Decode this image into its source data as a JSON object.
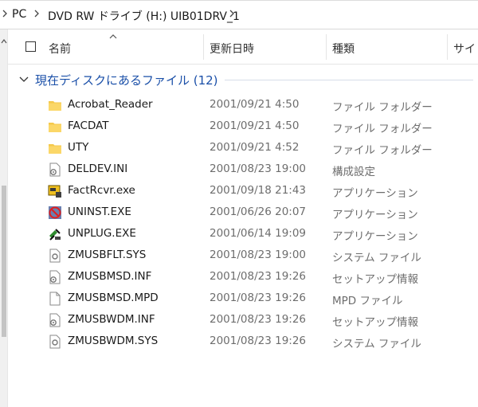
{
  "address": {
    "crumbs": [
      "PC",
      "DVD RW ドライブ (H:) UIB01DRV_1"
    ]
  },
  "columns": {
    "name": "名前",
    "modified": "更新日時",
    "type": "種類",
    "size": "サイ"
  },
  "group": {
    "title": "現在ディスクにあるファイル (12)"
  },
  "files": [
    {
      "name": "Acrobat_Reader",
      "date": "2001/09/21 4:50",
      "type": "ファイル フォルダー",
      "icon": "folder-icon"
    },
    {
      "name": "FACDAT",
      "date": "2001/09/21 4:50",
      "type": "ファイル フォルダー",
      "icon": "folder-icon"
    },
    {
      "name": "UTY",
      "date": "2001/09/21 4:52",
      "type": "ファイル フォルダー",
      "icon": "folder-icon"
    },
    {
      "name": "DELDEV.INI",
      "date": "2001/08/23 19:00",
      "type": "構成設定",
      "icon": "settings-file-icon"
    },
    {
      "name": "FactRcvr.exe",
      "date": "2001/09/18 21:43",
      "type": "アプリケーション",
      "icon": "app-icon"
    },
    {
      "name": "UNINST.EXE",
      "date": "2001/06/26 20:07",
      "type": "アプリケーション",
      "icon": "uninstall-app-icon"
    },
    {
      "name": "UNPLUG.EXE",
      "date": "2001/06/14 19:09",
      "type": "アプリケーション",
      "icon": "unplug-app-icon"
    },
    {
      "name": "ZMUSBFLT.SYS",
      "date": "2001/08/23 19:00",
      "type": "システム ファイル",
      "icon": "system-file-icon"
    },
    {
      "name": "ZMUSBMSD.INF",
      "date": "2001/08/23 19:26",
      "type": "セットアップ情報",
      "icon": "setup-info-icon"
    },
    {
      "name": "ZMUSBMSD.MPD",
      "date": "2001/08/23 19:26",
      "type": "MPD ファイル",
      "icon": "blank-file-icon"
    },
    {
      "name": "ZMUSBWDM.INF",
      "date": "2001/08/23 19:26",
      "type": "セットアップ情報",
      "icon": "setup-info-icon"
    },
    {
      "name": "ZMUSBWDM.SYS",
      "date": "2001/08/23 19:26",
      "type": "システム ファイル",
      "icon": "system-file-icon"
    }
  ]
}
